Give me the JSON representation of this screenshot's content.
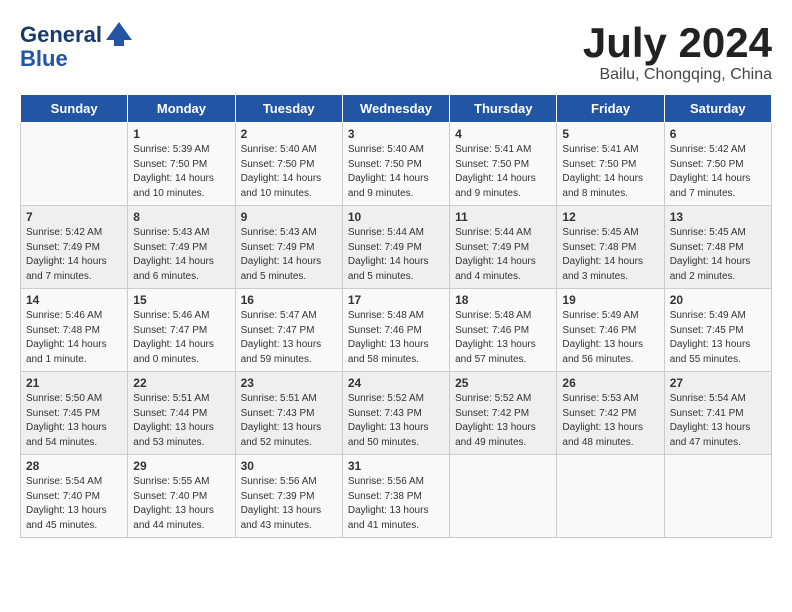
{
  "header": {
    "logo_line1": "General",
    "logo_line2": "Blue",
    "month_title": "July 2024",
    "location": "Bailu, Chongqing, China"
  },
  "days_of_week": [
    "Sunday",
    "Monday",
    "Tuesday",
    "Wednesday",
    "Thursday",
    "Friday",
    "Saturday"
  ],
  "weeks": [
    [
      {
        "day": "",
        "content": ""
      },
      {
        "day": "1",
        "content": "Sunrise: 5:39 AM\nSunset: 7:50 PM\nDaylight: 14 hours\nand 10 minutes."
      },
      {
        "day": "2",
        "content": "Sunrise: 5:40 AM\nSunset: 7:50 PM\nDaylight: 14 hours\nand 10 minutes."
      },
      {
        "day": "3",
        "content": "Sunrise: 5:40 AM\nSunset: 7:50 PM\nDaylight: 14 hours\nand 9 minutes."
      },
      {
        "day": "4",
        "content": "Sunrise: 5:41 AM\nSunset: 7:50 PM\nDaylight: 14 hours\nand 9 minutes."
      },
      {
        "day": "5",
        "content": "Sunrise: 5:41 AM\nSunset: 7:50 PM\nDaylight: 14 hours\nand 8 minutes."
      },
      {
        "day": "6",
        "content": "Sunrise: 5:42 AM\nSunset: 7:50 PM\nDaylight: 14 hours\nand 7 minutes."
      }
    ],
    [
      {
        "day": "7",
        "content": "Sunrise: 5:42 AM\nSunset: 7:49 PM\nDaylight: 14 hours\nand 7 minutes."
      },
      {
        "day": "8",
        "content": "Sunrise: 5:43 AM\nSunset: 7:49 PM\nDaylight: 14 hours\nand 6 minutes."
      },
      {
        "day": "9",
        "content": "Sunrise: 5:43 AM\nSunset: 7:49 PM\nDaylight: 14 hours\nand 5 minutes."
      },
      {
        "day": "10",
        "content": "Sunrise: 5:44 AM\nSunset: 7:49 PM\nDaylight: 14 hours\nand 5 minutes."
      },
      {
        "day": "11",
        "content": "Sunrise: 5:44 AM\nSunset: 7:49 PM\nDaylight: 14 hours\nand 4 minutes."
      },
      {
        "day": "12",
        "content": "Sunrise: 5:45 AM\nSunset: 7:48 PM\nDaylight: 14 hours\nand 3 minutes."
      },
      {
        "day": "13",
        "content": "Sunrise: 5:45 AM\nSunset: 7:48 PM\nDaylight: 14 hours\nand 2 minutes."
      }
    ],
    [
      {
        "day": "14",
        "content": "Sunrise: 5:46 AM\nSunset: 7:48 PM\nDaylight: 14 hours\nand 1 minute."
      },
      {
        "day": "15",
        "content": "Sunrise: 5:46 AM\nSunset: 7:47 PM\nDaylight: 14 hours\nand 0 minutes."
      },
      {
        "day": "16",
        "content": "Sunrise: 5:47 AM\nSunset: 7:47 PM\nDaylight: 13 hours\nand 59 minutes."
      },
      {
        "day": "17",
        "content": "Sunrise: 5:48 AM\nSunset: 7:46 PM\nDaylight: 13 hours\nand 58 minutes."
      },
      {
        "day": "18",
        "content": "Sunrise: 5:48 AM\nSunset: 7:46 PM\nDaylight: 13 hours\nand 57 minutes."
      },
      {
        "day": "19",
        "content": "Sunrise: 5:49 AM\nSunset: 7:46 PM\nDaylight: 13 hours\nand 56 minutes."
      },
      {
        "day": "20",
        "content": "Sunrise: 5:49 AM\nSunset: 7:45 PM\nDaylight: 13 hours\nand 55 minutes."
      }
    ],
    [
      {
        "day": "21",
        "content": "Sunrise: 5:50 AM\nSunset: 7:45 PM\nDaylight: 13 hours\nand 54 minutes."
      },
      {
        "day": "22",
        "content": "Sunrise: 5:51 AM\nSunset: 7:44 PM\nDaylight: 13 hours\nand 53 minutes."
      },
      {
        "day": "23",
        "content": "Sunrise: 5:51 AM\nSunset: 7:43 PM\nDaylight: 13 hours\nand 52 minutes."
      },
      {
        "day": "24",
        "content": "Sunrise: 5:52 AM\nSunset: 7:43 PM\nDaylight: 13 hours\nand 50 minutes."
      },
      {
        "day": "25",
        "content": "Sunrise: 5:52 AM\nSunset: 7:42 PM\nDaylight: 13 hours\nand 49 minutes."
      },
      {
        "day": "26",
        "content": "Sunrise: 5:53 AM\nSunset: 7:42 PM\nDaylight: 13 hours\nand 48 minutes."
      },
      {
        "day": "27",
        "content": "Sunrise: 5:54 AM\nSunset: 7:41 PM\nDaylight: 13 hours\nand 47 minutes."
      }
    ],
    [
      {
        "day": "28",
        "content": "Sunrise: 5:54 AM\nSunset: 7:40 PM\nDaylight: 13 hours\nand 45 minutes."
      },
      {
        "day": "29",
        "content": "Sunrise: 5:55 AM\nSunset: 7:40 PM\nDaylight: 13 hours\nand 44 minutes."
      },
      {
        "day": "30",
        "content": "Sunrise: 5:56 AM\nSunset: 7:39 PM\nDaylight: 13 hours\nand 43 minutes."
      },
      {
        "day": "31",
        "content": "Sunrise: 5:56 AM\nSunset: 7:38 PM\nDaylight: 13 hours\nand 41 minutes."
      },
      {
        "day": "",
        "content": ""
      },
      {
        "day": "",
        "content": ""
      },
      {
        "day": "",
        "content": ""
      }
    ]
  ]
}
